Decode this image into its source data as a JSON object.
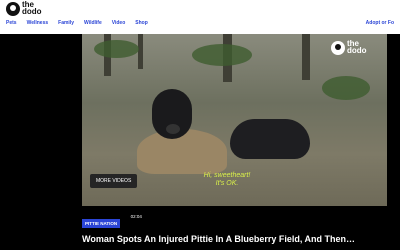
{
  "app": {
    "logo_text": "the dodo"
  },
  "nav": {
    "items": [
      "Pets",
      "Wellness",
      "Family",
      "Wildlife",
      "Video",
      "Shop"
    ],
    "adopt_label": "Adopt or Fo"
  },
  "video": {
    "watermark_text": "the dodo",
    "subtitle_line1": "Hi, sweetheart!",
    "subtitle_line2": "It's OK.",
    "more_videos_label": "MORE VIDEOS"
  },
  "article": {
    "tag": "PITTIE NATION",
    "duration": "02:04",
    "title": "Woman Spots An Injured Pittie In A Blueberry Field, And Then…"
  },
  "colors": {
    "brand": "#2b45d6",
    "subtitle": "#d8ef4a",
    "background": "#000000"
  }
}
